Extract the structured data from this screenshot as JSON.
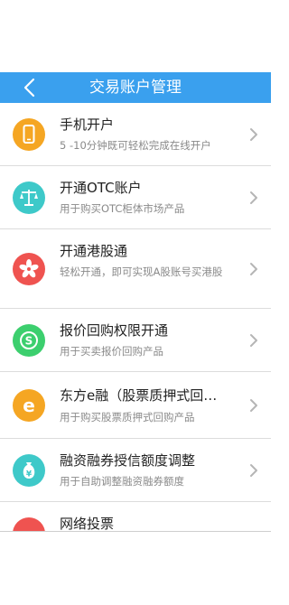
{
  "header": {
    "title": "交易账户管理",
    "color": "#3aa0ee"
  },
  "items": [
    {
      "title": "手机开户",
      "subtitle": "5 -10分钟既可轻松完成在线开户",
      "icon": "phone-icon",
      "icon_color": "#f5a623"
    },
    {
      "title": "开通OTC账户",
      "subtitle": "用于购买OTC柜体市场产品",
      "icon": "scale-icon",
      "icon_color": "#3ec9c9"
    },
    {
      "title": "开通港股通",
      "subtitle": "轻松开通，即可实现A股账号买港股",
      "icon": "bauhinia-icon",
      "icon_color": "#ef5350"
    },
    {
      "title": "报价回购权限开通",
      "subtitle": "用于买卖报价回购产品",
      "icon": "skype-icon",
      "icon_color": "#3ccf6e"
    },
    {
      "title": "东方e融（股票质押式回…",
      "subtitle": "用于购买股票质押式回购产品",
      "icon": "e-letter-icon",
      "icon_color": "#f5a623"
    },
    {
      "title": "融资融券授信额度调整",
      "subtitle": "用于自助调整融资融券额度",
      "icon": "money-bag-icon",
      "icon_color": "#3ec9c9"
    },
    {
      "title": "网络投票",
      "subtitle": "",
      "icon": "vote-icon",
      "icon_color": "#ef5350"
    }
  ]
}
